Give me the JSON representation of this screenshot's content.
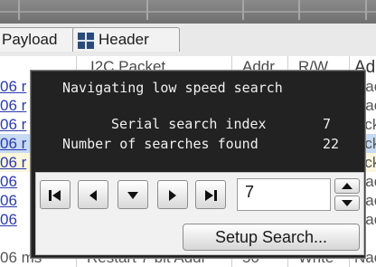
{
  "tabs": [
    {
      "label": "Payload"
    },
    {
      "label": "Header"
    }
  ],
  "table": {
    "columns": [
      "I2C Packet",
      "Addr",
      "R/W",
      "Ad"
    ],
    "rows": [
      {
        "time": "06 r",
        "ack": "Nac",
        "highlight": false
      },
      {
        "time": "06 r",
        "ack": "Nac",
        "highlight": false
      },
      {
        "time": "06 r",
        "ack": "Ack",
        "highlight": false
      },
      {
        "time": "06 r",
        "ack": "Ack",
        "highlight": true
      },
      {
        "time": "06 r",
        "ack": "Ack",
        "highlight": false
      },
      {
        "time": "06",
        "ack": "Nac",
        "highlight": false
      },
      {
        "time": "06",
        "ack": "Nac",
        "highlight": false
      },
      {
        "time": "06",
        "ack": "Nac",
        "highlight": false
      }
    ],
    "last_row": {
      "time": "06 ms",
      "packet": "Restart 7-bit Addr",
      "addr": "50",
      "rw": "Write",
      "ack": "Nac"
    }
  },
  "popup": {
    "title": "Navigating low speed search",
    "index_label": "Serial search index",
    "index_value": "7",
    "found_label": "Number of searches found",
    "found_value": "22",
    "index_input": "7",
    "setup_button": "Setup Search..."
  },
  "icons": {
    "first": "skip-to-first-icon",
    "prev": "previous-icon",
    "down": "down-arrow-icon",
    "next": "next-icon",
    "last": "skip-to-last-icon",
    "spin_up": "spin-up-icon",
    "spin_down": "spin-down-icon",
    "header_tab": "grid-icon"
  },
  "colors": {
    "popup_bg": "#222222",
    "terminal_text": "#f0f0f0",
    "link_text": "#2a3bb0",
    "row_highlight": "#c6daf2",
    "row_yellow": "#fbf6dc"
  }
}
